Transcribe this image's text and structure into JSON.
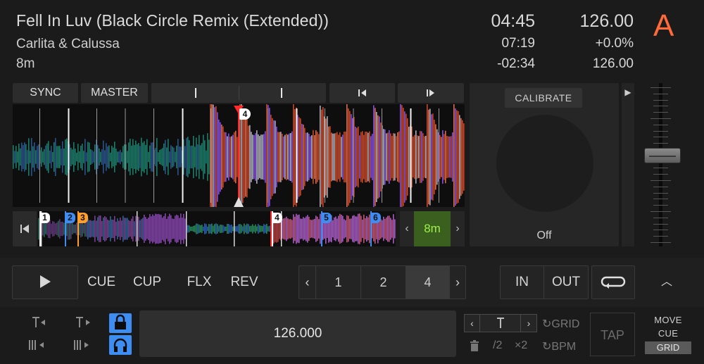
{
  "track": {
    "title": "Fell In Luv (Black Circle Remix (Extended))",
    "artist": "Carlita & Calussa",
    "key": "8m"
  },
  "readouts": {
    "time": "04:45",
    "remaining": "07:19",
    "elapsed_offset": "-02:34",
    "bpm": "126.00",
    "pitch": "+0.0%",
    "tempo": "126.00"
  },
  "deck_letter": "A",
  "accent_color": "#ff6a3a",
  "top_buttons": {
    "sync": "SYNC",
    "master": "MASTER"
  },
  "platter": {
    "calibrate": "CALIBRATE",
    "state": "Off"
  },
  "overview": {
    "cue_labels": [
      "1",
      "2",
      "3",
      "4",
      "5",
      "6"
    ],
    "loop_size": "8m",
    "loop_size_color": "#9cf04e"
  },
  "tempo_fader": {
    "level": 0.44
  },
  "transport": {
    "cue": "CUE",
    "cup": "CUP",
    "flx": "FLX",
    "rev": "REV",
    "beatjump": [
      "1",
      "2",
      "4"
    ],
    "beatjump_selected": "4",
    "in": "IN",
    "out": "OUT"
  },
  "grid": {
    "bpm_value": "126.000",
    "grid_label": "GRID",
    "half": "/2",
    "double": "×2",
    "bpm_label": "BPM",
    "tap": "TAP",
    "move_cue": [
      "MOVE",
      "CUE"
    ],
    "move_grid": "GRID",
    "lock_color": "#3e8df2"
  }
}
